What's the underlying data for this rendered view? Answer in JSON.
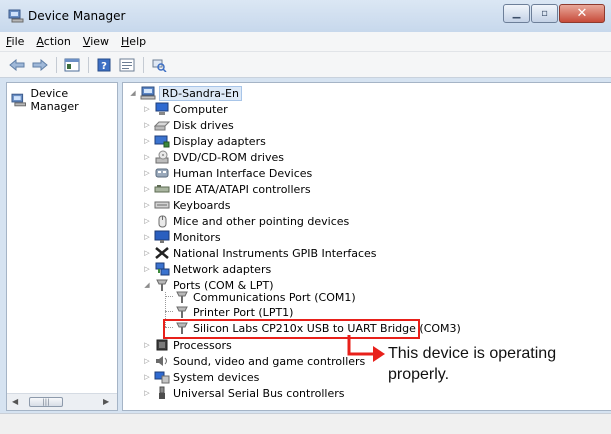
{
  "window": {
    "title": "Device Manager"
  },
  "menubar": {
    "items": [
      {
        "first": "F",
        "rest": "ile"
      },
      {
        "first": "A",
        "rest": "ction"
      },
      {
        "first": "V",
        "rest": "iew"
      },
      {
        "first": "H",
        "rest": "elp"
      }
    ]
  },
  "toolbar": {
    "buttons": [
      "back-arrow-icon",
      "forward-arrow-icon",
      "show-hide-console-tree-icon",
      "help-icon",
      "properties-icon",
      "scan-hardware-icon"
    ]
  },
  "left_pane": {
    "root_label": "Device Manager"
  },
  "tree": {
    "root": "RD-Sandra-En",
    "categories": [
      "Computer",
      "Disk drives",
      "Display adapters",
      "DVD/CD-ROM drives",
      "Human Interface Devices",
      "IDE ATA/ATAPI controllers",
      "Keyboards",
      "Mice and other pointing devices",
      "Monitors",
      "National Instruments GPIB Interfaces",
      "Network adapters",
      "Ports (COM & LPT)"
    ],
    "ports_children": [
      "Communications Port (COM1)",
      "Printer Port (LPT1)",
      "Silicon Labs CP210x USB to UART Bridge (COM3)"
    ],
    "categories_after": [
      "Processors",
      "Sound, video and game controllers",
      "System devices",
      "Universal Serial Bus controllers"
    ]
  },
  "annotation": {
    "text": "This device is operating properly.",
    "color": "#e8201a"
  }
}
